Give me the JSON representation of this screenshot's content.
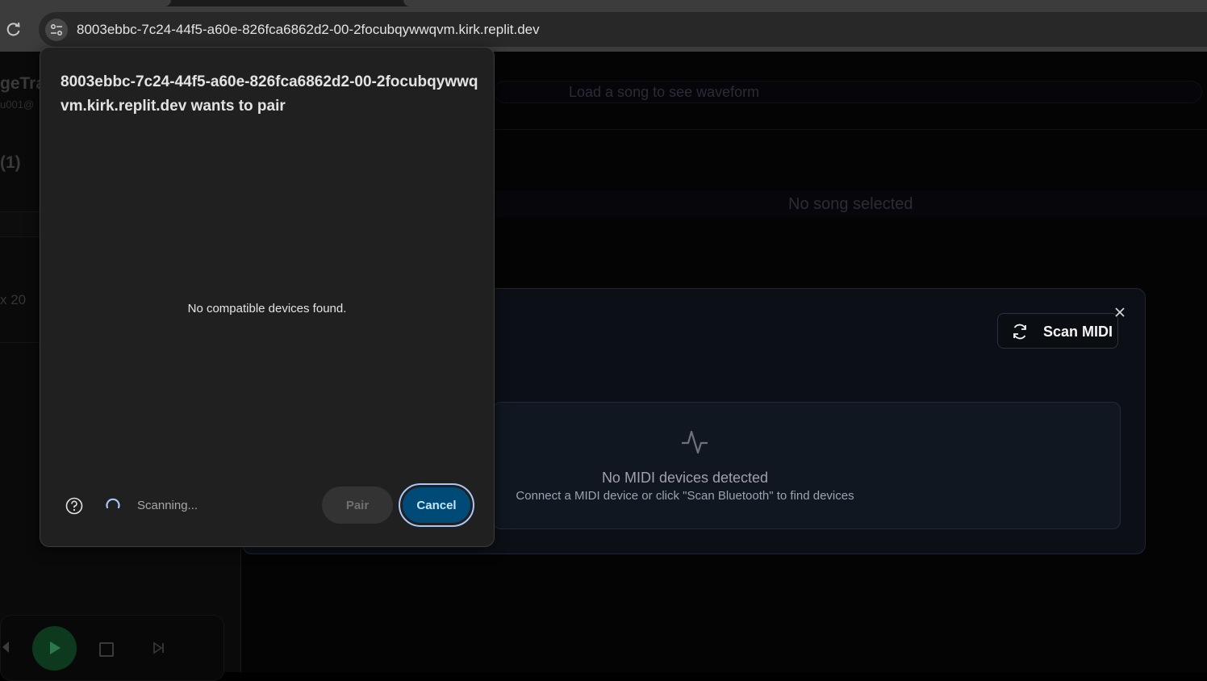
{
  "browser": {
    "url": "8003ebbc-7c24-44f5-a60e-826fca6862d2-00-2focubqywwqvm.kirk.replit.dev",
    "icons": {
      "reload": "reload-icon",
      "site_info": "tune-icon"
    }
  },
  "app": {
    "brand": "geTra",
    "email": "u001@",
    "section_count": "(1)",
    "loop_count": "x 20",
    "waveform_placeholder": "Load a song to see waveform",
    "no_song": "No song selected",
    "transport_icons": [
      "previous-icon",
      "play-icon",
      "stop-icon",
      "skip-forward-icon"
    ]
  },
  "midi": {
    "scan_label": "Scan MIDI",
    "empty_title": "No MIDI devices detected",
    "empty_subtitle": "Connect a MIDI device or click \"Scan Bluetooth\" to find devices",
    "icons": {
      "scan": "refresh-icon",
      "close": "close-icon",
      "empty": "activity-pulse-icon"
    }
  },
  "pair_dialog": {
    "title": "8003ebbc-7c24-44f5-a60e-826fca6862d2-00-2focubqywwqvm.kirk.replit.dev wants to pair",
    "empty_message": "No compatible devices found.",
    "status": "Scanning...",
    "pair_label": "Pair",
    "cancel_label": "Cancel",
    "accent": "#004a77"
  }
}
